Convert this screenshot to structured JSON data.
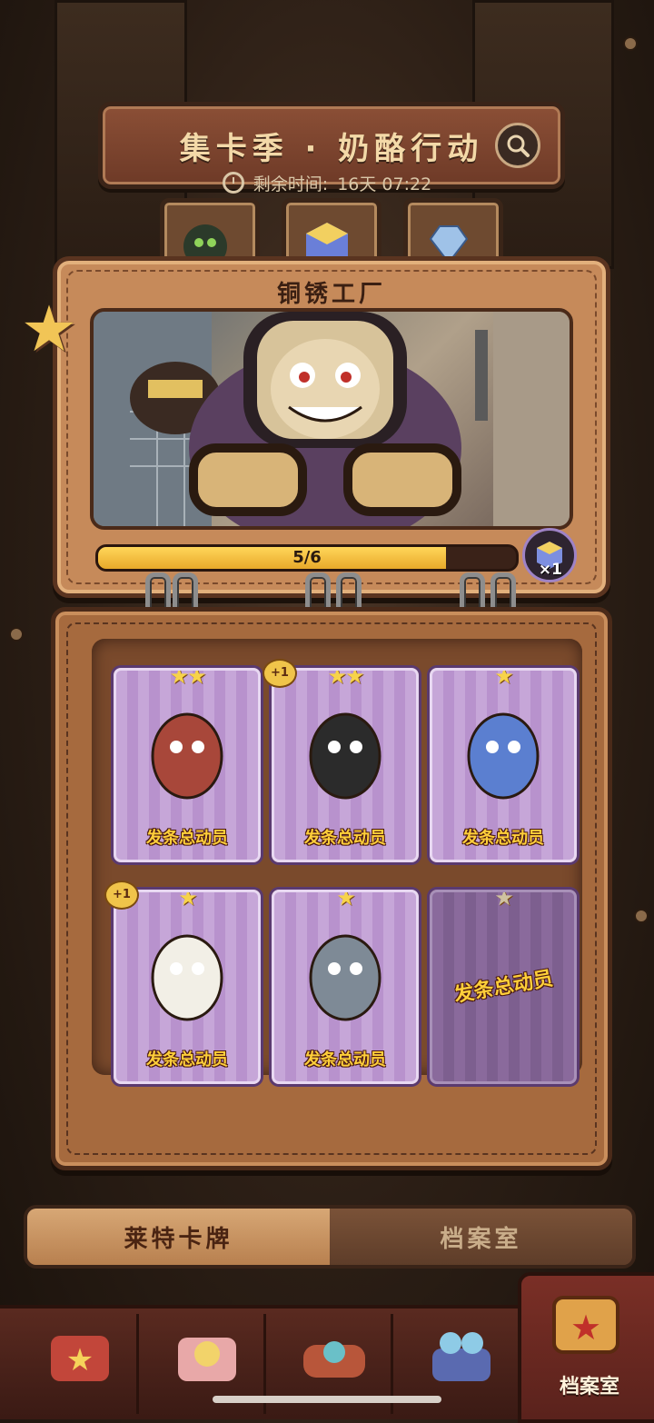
{
  "header": {
    "title": "集卡季 · 奶酪行动",
    "timer_label": "剩余时间:",
    "timer_value": "16天 07:22"
  },
  "album": {
    "title": "铜锈工厂",
    "progress": {
      "collected": 5,
      "total": 6,
      "text": "5/6",
      "fraction": 0.833
    },
    "reward": {
      "icon": "crystal-cube-icon",
      "count": "×1"
    }
  },
  "cards": [
    {
      "name": "card-1",
      "stars": 2,
      "plus": "",
      "logo": "发条总动员",
      "collected": true
    },
    {
      "name": "card-2",
      "stars": 2,
      "plus": "+1",
      "logo": "发条总动员",
      "collected": true
    },
    {
      "name": "card-3",
      "stars": 1,
      "plus": "",
      "logo": "发条总动员",
      "collected": true
    },
    {
      "name": "card-4",
      "stars": 1,
      "plus": "+1",
      "logo": "发条总动员",
      "collected": true
    },
    {
      "name": "card-5",
      "stars": 1,
      "plus": "",
      "logo": "发条总动员",
      "collected": true
    },
    {
      "name": "card-6",
      "stars": 1,
      "plus": "",
      "logo": "发条总动员",
      "collected": false
    }
  ],
  "tabs": {
    "active": "莱特卡牌",
    "inactive": "档案室"
  },
  "dock": {
    "active_label": "档案室"
  },
  "colors": {
    "accent": "#f1c556",
    "card_purple": "#c6a6d8",
    "leather": "#c68a5a"
  }
}
